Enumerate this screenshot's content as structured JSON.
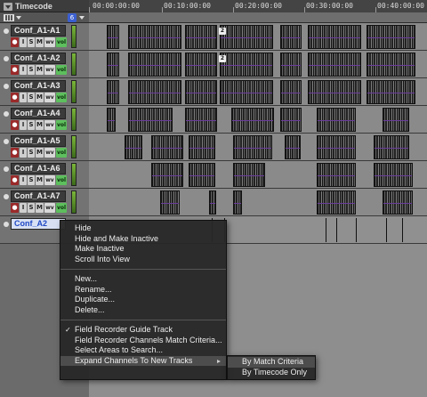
{
  "header": {
    "ruler_label": "Timecode",
    "timecodes": [
      "00:00:00:00",
      "00:10:00:00",
      "00:20:00:00",
      "00:30:00:00",
      "00:40:00:00"
    ],
    "track_count_badge": "6"
  },
  "tracks": [
    {
      "name": "Conf_A1-A1"
    },
    {
      "name": "Conf_A1-A2"
    },
    {
      "name": "Conf_A1-A3"
    },
    {
      "name": "Conf_A1-A4"
    },
    {
      "name": "Conf_A1-A5"
    },
    {
      "name": "Conf_A1-A6"
    },
    {
      "name": "Conf_A1-A7"
    },
    {
      "name": "Conf_A2"
    }
  ],
  "track_controls": {
    "rec": "●",
    "i": "I",
    "s": "S",
    "m": "M",
    "wv": "wv",
    "vol": "vol"
  },
  "clip_markers": {
    "a1": "2",
    "a2": "2"
  },
  "menu": {
    "items_group1": [
      "Hide",
      "Hide and Make Inactive",
      "Make Inactive",
      "Scroll Into View"
    ],
    "items_group2": [
      "New...",
      "Rename...",
      "Duplicate...",
      "Delete..."
    ],
    "items_group3": [
      "Field Recorder Guide Track",
      "Field Recorder Channels Match Criteria...",
      "Select Areas to Search...",
      "Expand Channels To New Tracks"
    ],
    "checked_item": "Field Recorder Guide Track",
    "submenu": [
      "By Match Criteria",
      "By Timecode Only"
    ]
  },
  "colors": {
    "selected_track_text": "#1f48c4",
    "menu_bg": "#282828",
    "accent_badge": "#3b5fd0"
  }
}
